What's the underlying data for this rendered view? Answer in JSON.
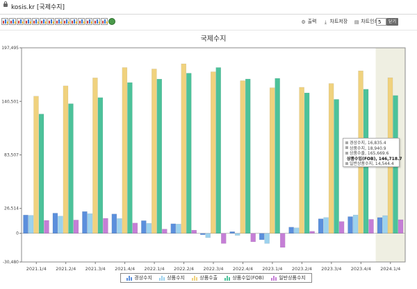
{
  "window": {
    "title": "kosis.kr [국제수지]"
  },
  "toolbar": {
    "chart_type_icons": [
      "bar-chart-icon",
      "stacked-bar-icon",
      "line-chart-icon",
      "area-chart-icon",
      "pie-chart-icon",
      "column-chart-icon",
      "stacked-column-icon",
      "horizontal-bar-icon",
      "horizontal-stacked-icon",
      "scatter-icon",
      "combo-chart-icon",
      "mixed-chart-icon",
      "radar-chart-icon",
      "bubble-chart-icon",
      "refresh-icon"
    ],
    "print_label": "출력",
    "save_label": "차트저장",
    "print_chart_label": "차트인쇄",
    "count_value": "5",
    "close_label": "닫기"
  },
  "colors": {
    "current_account": "#5b8fdc",
    "goods_balance": "#9cd2ee",
    "exports": "#f0d27e",
    "imports": "#4cc29a",
    "general_trade": "#c57ed6",
    "highlight_band": "#efefe2"
  },
  "chart_data": {
    "type": "bar",
    "title": "국제수지",
    "categories": [
      "2021.1/4",
      "2021.2/4",
      "2021.3/4",
      "2021.4/4",
      "2022.1/4",
      "2022.2/4",
      "2022.3/4",
      "2022.4/4",
      "2023.1/4",
      "2023.2/4",
      "2023.3/4",
      "2023.4/4",
      "2024.1/4"
    ],
    "y_ticks": [
      "197,495",
      "140,501",
      "83,507",
      "26,514",
      "0",
      "-30,480"
    ],
    "ylim": [
      -30480,
      197495
    ],
    "grid": false,
    "legend_position": "bottom",
    "highlight_category": "2024.1/4",
    "series": [
      {
        "name": "경상수지",
        "values": [
          19500,
          21500,
          23200,
          20600,
          13500,
          10200,
          -1500,
          1800,
          -6800,
          6600,
          15500,
          17800,
          16835.4
        ]
      },
      {
        "name": "상품수지",
        "values": [
          19200,
          18400,
          21000,
          15800,
          10700,
          9900,
          -4600,
          -2200,
          -10800,
          5900,
          16900,
          19600,
          18940.9
        ]
      },
      {
        "name": "상품수출",
        "values": [
          146000,
          157000,
          165500,
          176500,
          175000,
          180500,
          172000,
          162500,
          155000,
          155500,
          159500,
          173000,
          165669.6
        ]
      },
      {
        "name": "상품수입(FOB)",
        "values": [
          127000,
          138000,
          144500,
          160500,
          164200,
          170500,
          176500,
          164300,
          165000,
          149500,
          142600,
          153400,
          146718.7
        ]
      },
      {
        "name": "일반상품수지",
        "values": [
          13800,
          14200,
          16000,
          11000,
          4500,
          3400,
          -10800,
          -9000,
          -15000,
          2200,
          12600,
          14900,
          14544.4
        ]
      }
    ],
    "tooltip": {
      "category": "2024.1/4",
      "highlighted_series": "상품수입(FOB)",
      "lines": [
        "경상수지, 16,835.4",
        "상품수지, 18,940.9",
        "상품수출, 165,669.6",
        "상품수입(FOB), 146,718.7",
        "일반상품수지, 14,544.4"
      ]
    }
  }
}
